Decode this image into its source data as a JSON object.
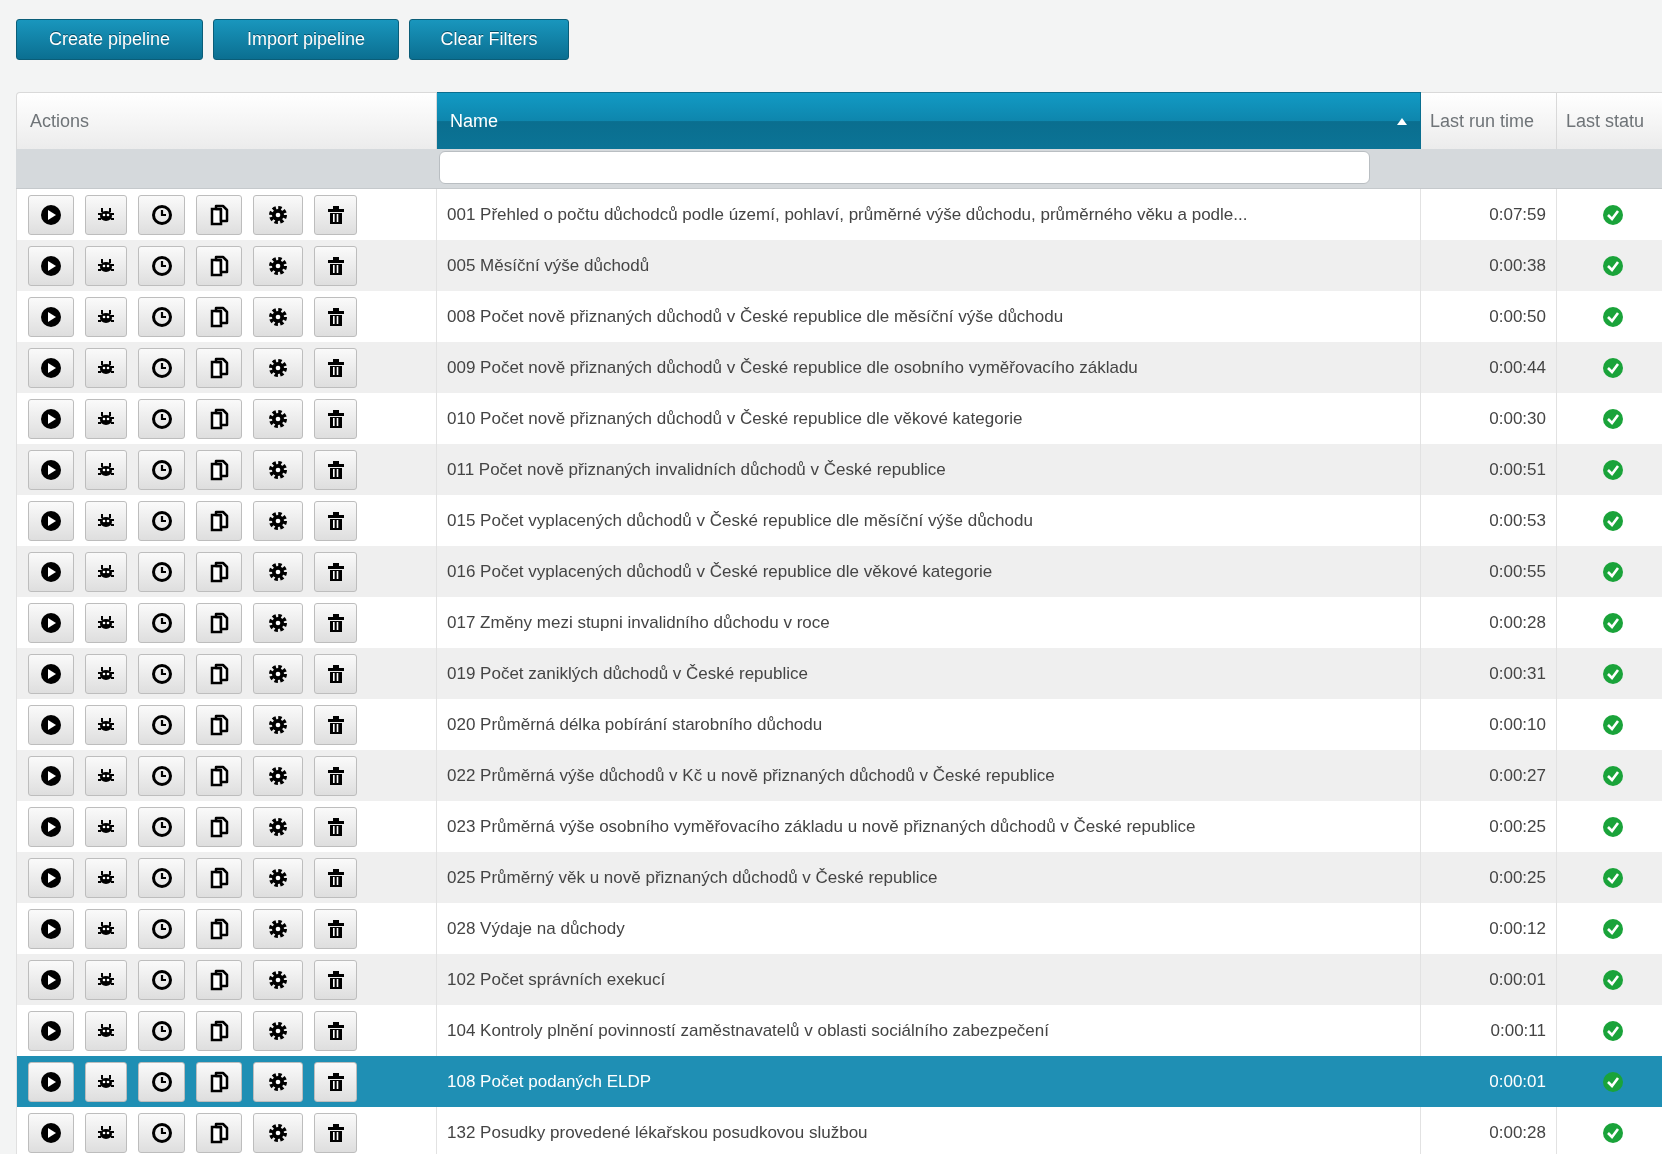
{
  "toolbar": {
    "buttons": [
      "Create pipeline",
      "Import pipeline",
      "Clear Filters"
    ]
  },
  "table": {
    "columns": [
      {
        "label": "Actions",
        "sorted": false
      },
      {
        "label": "Name",
        "sorted": true
      },
      {
        "label": "Last run time",
        "sorted": false
      },
      {
        "label": "Last statu",
        "sorted": false
      }
    ],
    "rows": [
      {
        "name": "001 Přehled o počtu důchodců podle území, pohlaví, průměrné výše důchodu, průměrného věku a podle...",
        "last_run_time": "0:07:59",
        "ok": true,
        "selected": false
      },
      {
        "name": "005 Měsíční výše důchodů",
        "last_run_time": "0:00:38",
        "ok": true,
        "selected": false
      },
      {
        "name": "008 Počet nově přiznaných důchodů v České republice dle měsíční výše důchodu",
        "last_run_time": "0:00:50",
        "ok": true,
        "selected": false
      },
      {
        "name": "009 Počet nově přiznaných důchodů v České republice dle osobního vyměřovacího základu",
        "last_run_time": "0:00:44",
        "ok": true,
        "selected": false
      },
      {
        "name": "010 Počet nově přiznaných důchodů v České republice dle věkové kategorie",
        "last_run_time": "0:00:30",
        "ok": true,
        "selected": false
      },
      {
        "name": "011 Počet nově přiznaných invalidních důchodů v České republice",
        "last_run_time": "0:00:51",
        "ok": true,
        "selected": false
      },
      {
        "name": "015 Počet vyplacených důchodů v České republice dle měsíční výše důchodu",
        "last_run_time": "0:00:53",
        "ok": true,
        "selected": false
      },
      {
        "name": "016 Počet vyplacených důchodů v České republice dle věkové kategorie",
        "last_run_time": "0:00:55",
        "ok": true,
        "selected": false
      },
      {
        "name": "017 Změny mezi stupni invalidního důchodu v roce",
        "last_run_time": "0:00:28",
        "ok": true,
        "selected": false
      },
      {
        "name": "019 Počet zaniklých důchodů v České republice",
        "last_run_time": "0:00:31",
        "ok": true,
        "selected": false
      },
      {
        "name": "020 Průměrná délka pobírání starobního důchodu",
        "last_run_time": "0:00:10",
        "ok": true,
        "selected": false
      },
      {
        "name": "022 Průměrná výše důchodů v Kč u nově přiznaných důchodů v České republice",
        "last_run_time": "0:00:27",
        "ok": true,
        "selected": false
      },
      {
        "name": "023 Průměrná výše osobního vyměřovacího základu u nově přiznaných důchodů v České republice",
        "last_run_time": "0:00:25",
        "ok": true,
        "selected": false
      },
      {
        "name": "025 Průměrný věk u nově přiznaných důchodů v České republice",
        "last_run_time": "0:00:25",
        "ok": true,
        "selected": false
      },
      {
        "name": "028 Výdaje na důchody",
        "last_run_time": "0:00:12",
        "ok": true,
        "selected": false
      },
      {
        "name": "102 Počet správních exekucí",
        "last_run_time": "0:00:01",
        "ok": true,
        "selected": false
      },
      {
        "name": "104 Kontroly plnění povinností zaměstnavatelů v oblasti sociálního zabezpečení",
        "last_run_time": "0:00:11",
        "ok": true,
        "selected": false
      },
      {
        "name": "108 Počet podaných ELDP",
        "last_run_time": "0:00:01",
        "ok": true,
        "selected": true
      },
      {
        "name": "132 Posudky provedené lékařskou posudkovou službou",
        "last_run_time": "0:00:28",
        "ok": true,
        "selected": false
      }
    ]
  }
}
